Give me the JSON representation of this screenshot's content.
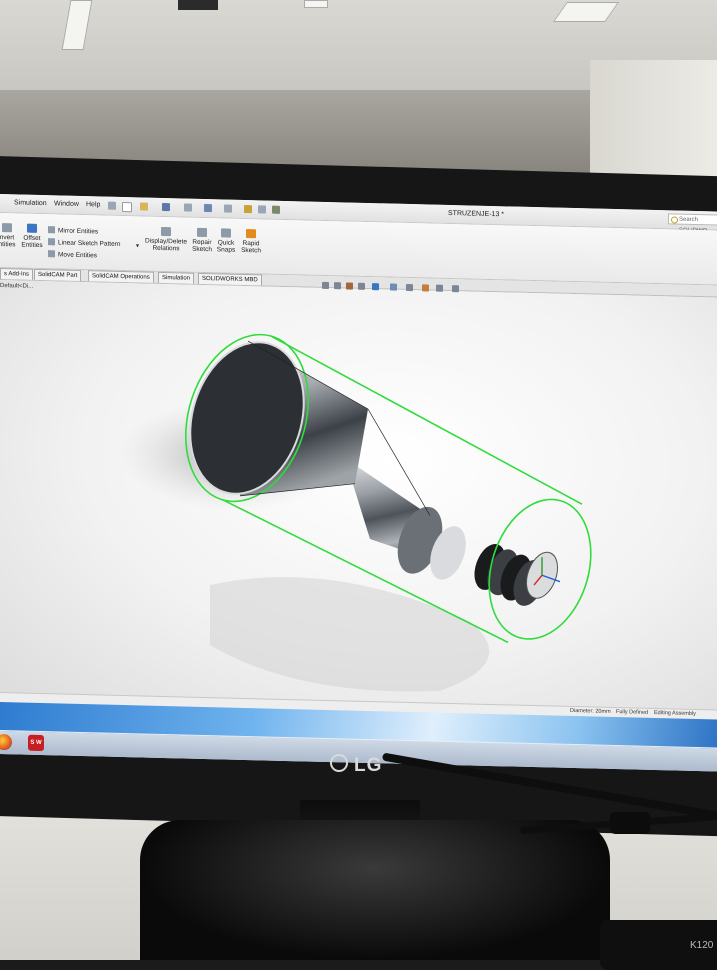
{
  "menubar": {
    "items": [
      "Simulation",
      "Window",
      "Help"
    ],
    "document_title": "STRUZENJE-13 *",
    "search_placeholder": "Search SOLIDWO"
  },
  "ribbon": {
    "convert_entities": "nvert\nntities",
    "offset_entities": "Offset\nEntities",
    "mirror_entities": "Mirror Entities",
    "linear_sketch_pattern": "Linear Sketch Pattern",
    "move_entities": "Move Entities",
    "display_delete_relations": "Display/Delete\nRelations",
    "repair_sketch": "Repair\nSketch",
    "quick_snaps": "Quick\nSnaps",
    "rapid_sketch": "Rapid\nSketch"
  },
  "command_tabs": [
    "s Add-Ins",
    "SolidCAM Part",
    "SolidCAM Operations",
    "Simulation",
    "SOLIDWORKS MBD"
  ],
  "breadcrumb": "Default<Di...",
  "statusbar": {
    "dimension": "Diameter: 20mm",
    "definition": "Fully Defined",
    "mode": "Editing Assembly"
  },
  "taskbar": {
    "solidworks_label": "S W"
  },
  "monitor": {
    "brand": "LG",
    "keyboard_label": "K120"
  },
  "colors": {
    "sketch_green": "#2fdc3c",
    "part_steel": "#8d9298",
    "ribbon_bg": "#eeeeee"
  }
}
